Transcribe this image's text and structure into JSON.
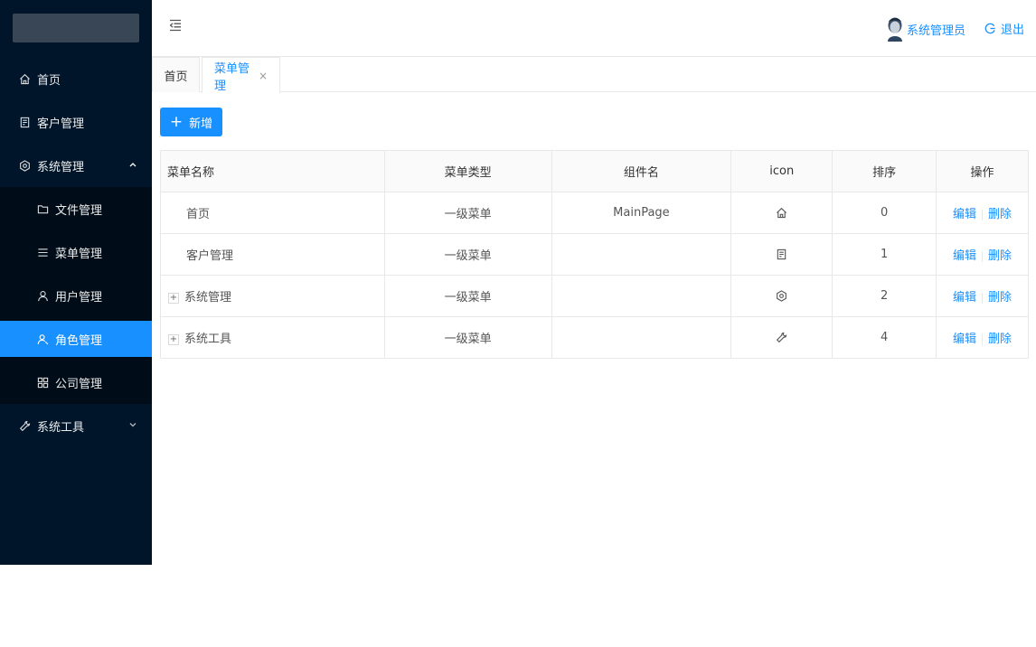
{
  "sidebar": {
    "items": [
      {
        "label": "首页",
        "icon": "home-icon"
      },
      {
        "label": "客户管理",
        "icon": "file-text-icon"
      },
      {
        "label": "系统管理",
        "icon": "setting-icon",
        "expanded": true
      },
      {
        "label": "文件管理",
        "icon": "folder-icon"
      },
      {
        "label": "菜单管理",
        "icon": "menu-icon"
      },
      {
        "label": "用户管理",
        "icon": "user-icon"
      },
      {
        "label": "角色管理",
        "icon": "team-icon",
        "active": true
      },
      {
        "label": "公司管理",
        "icon": "appstore-icon"
      },
      {
        "label": "系统工具",
        "icon": "tool-icon",
        "expanded": false
      }
    ]
  },
  "header": {
    "user_name": "系统管理员",
    "logout_label": "退出"
  },
  "tabs": [
    {
      "label": "首页"
    },
    {
      "label": "菜单管理",
      "active": true,
      "close": "×"
    }
  ],
  "toolbar": {
    "add_label": "新增",
    "add_plus": "+"
  },
  "table": {
    "columns": [
      "菜单名称",
      "菜单类型",
      "组件名",
      "icon",
      "排序",
      "操作"
    ],
    "rows": [
      {
        "name": "首页",
        "type": "一级菜单",
        "component": "MainPage",
        "icon": "home-icon",
        "sort": "0",
        "expandable": false
      },
      {
        "name": "客户管理",
        "type": "一级菜单",
        "component": "",
        "icon": "file-text-icon",
        "sort": "1",
        "expandable": false
      },
      {
        "name": "系统管理",
        "type": "一级菜单",
        "component": "",
        "icon": "setting-icon",
        "sort": "2",
        "expandable": true
      },
      {
        "name": "系统工具",
        "type": "一级菜单",
        "component": "",
        "icon": "tool-icon",
        "sort": "4",
        "expandable": true
      }
    ],
    "edit_label": "编辑",
    "delete_label": "删除",
    "expand_symbol": "+"
  },
  "colors": {
    "primary": "#1890ff",
    "sidebar_bg": "#001529",
    "submenu_bg": "#000c17"
  }
}
